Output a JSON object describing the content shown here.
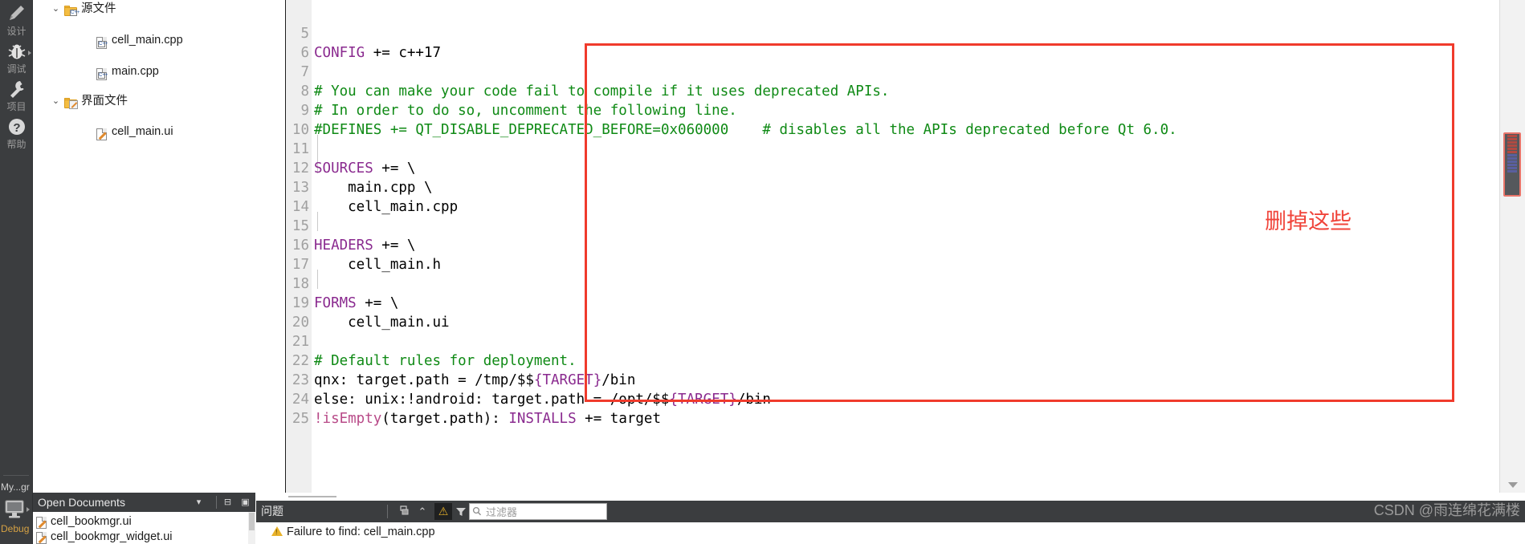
{
  "mode_bar": {
    "items": [
      {
        "label": "设计",
        "icon": "pencil-icon",
        "has_arrow": false
      },
      {
        "label": "调试",
        "icon": "bug-icon",
        "has_arrow": true
      },
      {
        "label": "项目",
        "icon": "wrench-icon",
        "has_arrow": false
      },
      {
        "label": "帮助",
        "icon": "question-mark-icon",
        "has_arrow": false
      }
    ],
    "kit": {
      "name": "My...gr",
      "icon": "desktop-icon",
      "build_config": "Debug"
    }
  },
  "project_tree": {
    "rows": [
      {
        "indent": 0,
        "chevron": "⌄",
        "icon": "folder-cpp-icon",
        "label": "源文件"
      },
      {
        "indent": 1,
        "chevron": "",
        "icon": "file-cpp-icon",
        "label": "cell_main.cpp"
      },
      {
        "indent": 1,
        "chevron": "",
        "icon": "file-cpp-icon",
        "label": "main.cpp"
      },
      {
        "indent": 0,
        "chevron": "⌄",
        "icon": "folder-ui-icon",
        "label": "界面文件"
      },
      {
        "indent": 1,
        "chevron": "",
        "icon": "file-ui-icon",
        "label": "cell_main.ui"
      }
    ]
  },
  "open_documents": {
    "title": "Open Documents",
    "buttons": [
      {
        "name": "dropdown-arrow",
        "glyph": "▾"
      },
      {
        "name": "split-editor",
        "glyph": "⊟"
      },
      {
        "name": "close-panel",
        "glyph": "▣"
      }
    ],
    "items": [
      {
        "icon": "file-ui-icon",
        "label": "cell_bookmgr.ui"
      },
      {
        "icon": "file-ui-icon",
        "label": "cell_bookmgr_widget.ui"
      }
    ]
  },
  "editor": {
    "first_visible_line": 5,
    "lines": [
      {
        "no": "5",
        "tokens": [
          {
            "t": "CONFIG",
            "c": "var"
          },
          {
            "t": " += c++17",
            "c": "plain"
          }
        ]
      },
      {
        "no": "6",
        "tokens": []
      },
      {
        "no": "7",
        "tokens": [
          {
            "t": "# You can make your code fail to compile if it uses deprecated APIs.",
            "c": "comment"
          }
        ]
      },
      {
        "no": "8",
        "tokens": [
          {
            "t": "# In order to do so, uncomment the following line.",
            "c": "comment"
          }
        ]
      },
      {
        "no": "9",
        "tokens": [
          {
            "t": "#DEFINES += QT_DISABLE_DEPRECATED_BEFORE=0x060000    # disables all the APIs deprecated before Qt 6.0.",
            "c": "comment"
          }
        ]
      },
      {
        "no": "10",
        "tokens": []
      },
      {
        "no": "11",
        "tokens": [
          {
            "t": "SOURCES",
            "c": "var"
          },
          {
            "t": " += \\",
            "c": "plain"
          }
        ]
      },
      {
        "no": "12",
        "tokens": [
          {
            "t": "    main.cpp \\",
            "c": "plain"
          }
        ]
      },
      {
        "no": "13",
        "tokens": [
          {
            "t": "    cell_main.cpp",
            "c": "plain"
          }
        ]
      },
      {
        "no": "14",
        "tokens": []
      },
      {
        "no": "15",
        "tokens": [
          {
            "t": "HEADERS",
            "c": "var"
          },
          {
            "t": " += \\",
            "c": "plain"
          }
        ]
      },
      {
        "no": "16",
        "tokens": [
          {
            "t": "    cell_main.h",
            "c": "plain"
          }
        ]
      },
      {
        "no": "17",
        "tokens": []
      },
      {
        "no": "18",
        "tokens": [
          {
            "t": "FORMS",
            "c": "var"
          },
          {
            "t": " += \\",
            "c": "plain"
          }
        ]
      },
      {
        "no": "19",
        "tokens": [
          {
            "t": "    cell_main.ui",
            "c": "plain"
          }
        ]
      },
      {
        "no": "20",
        "tokens": []
      },
      {
        "no": "21",
        "tokens": [
          {
            "t": "# Default rules for deployment.",
            "c": "comment"
          }
        ]
      },
      {
        "no": "22",
        "tokens": [
          {
            "t": "qnx: target.path = /tmp/$$",
            "c": "plain"
          },
          {
            "t": "{TARGET}",
            "c": "var"
          },
          {
            "t": "/bin",
            "c": "plain"
          }
        ]
      },
      {
        "no": "23",
        "tokens": [
          {
            "t": "else: unix:!android: target.path = /opt/$$",
            "c": "plain"
          },
          {
            "t": "{TARGET}",
            "c": "var"
          },
          {
            "t": "/bin",
            "c": "plain"
          }
        ]
      },
      {
        "no": "24",
        "tokens": [
          {
            "t": "!",
            "c": "func"
          },
          {
            "t": "isEmpty",
            "c": "func"
          },
          {
            "t": "(target.path): ",
            "c": "plain"
          },
          {
            "t": "INSTALLS",
            "c": "var"
          },
          {
            "t": " += target",
            "c": "plain"
          }
        ]
      },
      {
        "no": "25",
        "tokens": []
      }
    ],
    "annotation": {
      "text": "删掉这些",
      "color": "#f0443a",
      "box_color": "#f03b2c"
    }
  },
  "issues_panel": {
    "title": "问题",
    "toolbar": [
      {
        "name": "copy-issue-button",
        "glyph": "⎙"
      },
      {
        "name": "previous-issue-button",
        "glyph": "⌃"
      },
      {
        "name": "next-issue-button",
        "glyph": "⌄"
      }
    ],
    "warning_filter_glyph": "⚠",
    "filter_icon": "filter-icon",
    "filter_placeholder": "过滤器",
    "filter_value": "",
    "rows": [
      {
        "severity": "warning",
        "text": "Failure to find: cell_main.cpp"
      }
    ]
  },
  "watermark": "CSDN @雨连绵花满楼"
}
